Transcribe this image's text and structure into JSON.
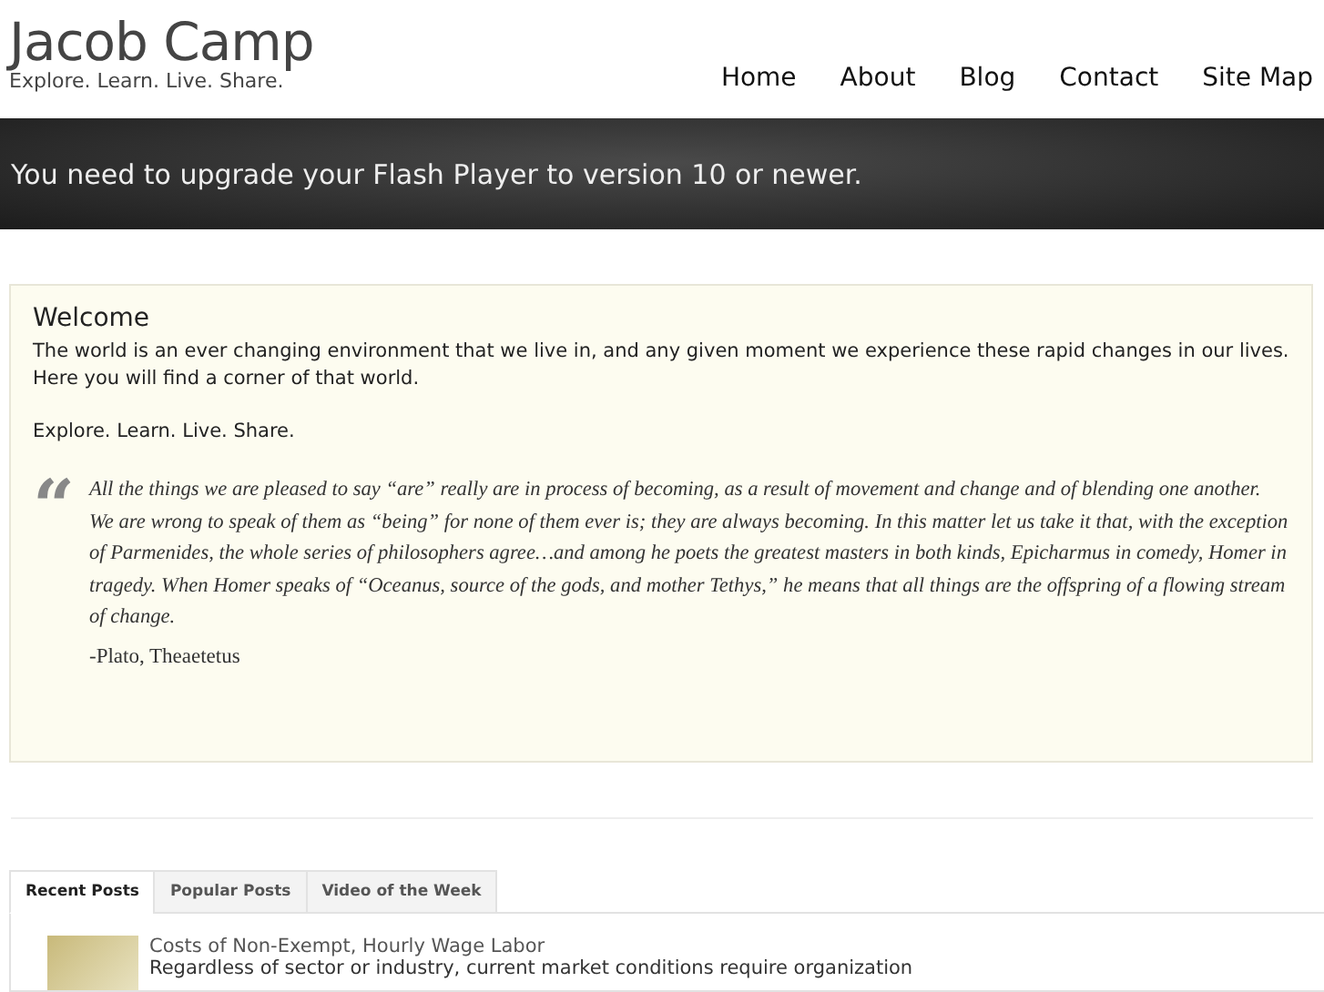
{
  "site": {
    "title": "Jacob Camp",
    "tagline": "Explore. Learn. Live. Share."
  },
  "nav": [
    {
      "label": "Home"
    },
    {
      "label": "About"
    },
    {
      "label": "Blog"
    },
    {
      "label": "Contact"
    },
    {
      "label": "Site Map"
    }
  ],
  "banner": {
    "message": "You need to upgrade your Flash Player to version 10 or newer."
  },
  "welcome": {
    "heading": "Welcome",
    "paragraphs": [
      "The world is an ever changing environment that we live in, and any given moment we experience these rapid changes in our lives. Here you will find a corner of that world.",
      "Explore. Learn. Live. Share."
    ],
    "quote_mark": "“",
    "quote": "All the things we are pleased to say “are” really are in process of becoming, as a result of movement and change and of blending one another. We are wrong to speak of them as “being” for none of them ever is; they are always becoming. In this matter let us take it that, with the exception of Parmenides, the whole series of philosophers agree…and among he poets the greatest masters in both kinds, Epicharmus in comedy, Homer in tragedy. When Homer speaks of “Oceanus, source of the gods, and mother Tethys,” he means that all things are the offspring of a flowing stream of change.",
    "attribution": "-Plato, Theaetetus"
  },
  "tabs": [
    {
      "label": "Recent Posts",
      "selected": true
    },
    {
      "label": "Popular Posts",
      "selected": false
    },
    {
      "label": "Video of the Week",
      "selected": false
    }
  ],
  "posts": [
    {
      "title": "Costs of Non-Exempt, Hourly Wage Labor",
      "excerpt": "Regardless of sector or industry, current market conditions require organization"
    }
  ]
}
